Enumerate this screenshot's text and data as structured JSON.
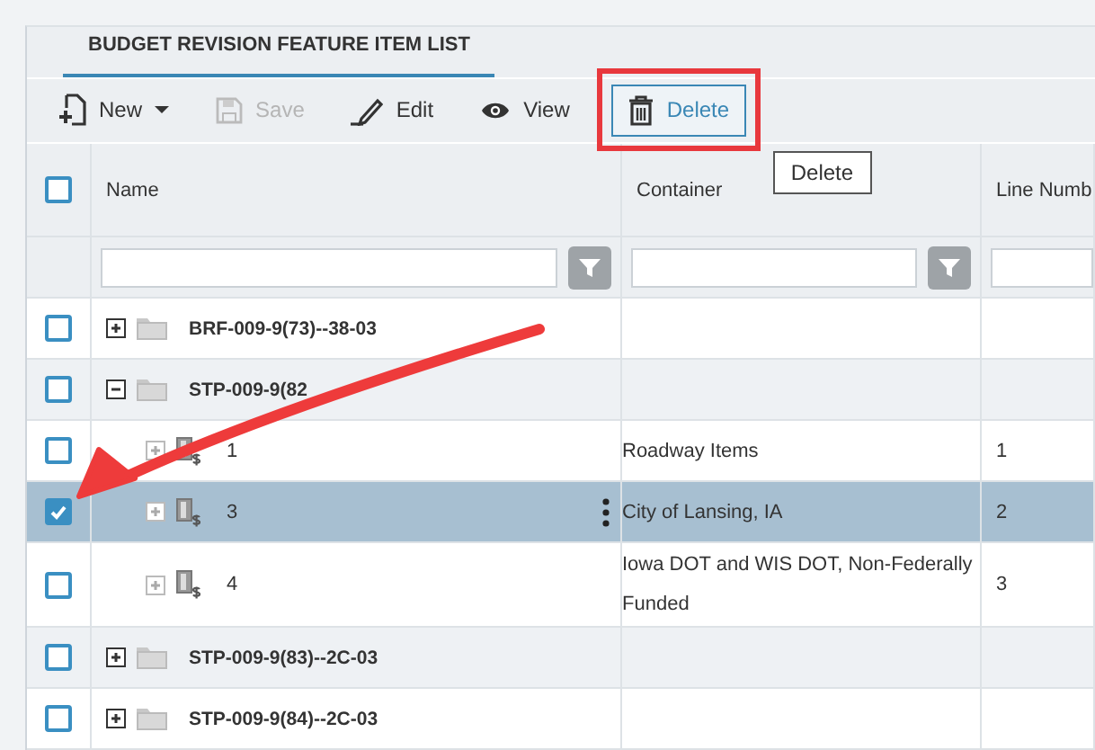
{
  "tab": {
    "label": "BUDGET REVISION FEATURE ITEM LIST",
    "selected": true
  },
  "toolbar": [
    {
      "kind": "new",
      "label": "New",
      "dropdown": true,
      "disabled": false,
      "hovered": false
    },
    {
      "kind": "save",
      "label": "Save",
      "dropdown": false,
      "disabled": true,
      "hovered": false
    },
    {
      "kind": "edit",
      "label": "Edit",
      "dropdown": false,
      "disabled": false,
      "hovered": false
    },
    {
      "kind": "view",
      "label": "View",
      "dropdown": false,
      "disabled": false,
      "hovered": false
    },
    {
      "kind": "delete",
      "label": "Delete",
      "dropdown": false,
      "disabled": false,
      "hovered": true
    }
  ],
  "tooltip": "Delete",
  "table": {
    "select_all": {
      "checked": false
    },
    "columns": [
      {
        "label": "Name",
        "filter_button": true
      },
      {
        "label": "Container",
        "filter_button": true
      },
      {
        "label": "Line Numb",
        "filter_button": false
      }
    ],
    "rows": [
      {
        "kind": "folder",
        "name": "BRF-009-9(73)--38-03",
        "checked": false,
        "selected": false,
        "expanded": false
      },
      {
        "kind": "folder",
        "name": "STP-009-9(82",
        "checked": false,
        "selected": false,
        "expanded": true,
        "children": [
          {
            "kind": "item",
            "name": "1",
            "container": "Roadway Items",
            "line_number": "1",
            "checked": false,
            "selected": false,
            "expanded": false
          },
          {
            "kind": "item",
            "name": "3",
            "container": "City of Lansing, IA",
            "line_number": "2",
            "checked": true,
            "selected": true,
            "expanded": false
          },
          {
            "kind": "item",
            "name": "4",
            "container": "Iowa DOT and WIS DOT, Non-Federally Funded",
            "line_number": "3",
            "checked": false,
            "selected": false,
            "expanded": false
          }
        ]
      },
      {
        "kind": "folder",
        "name": "STP-009-9(83)--2C-03",
        "checked": false,
        "selected": false,
        "expanded": false
      },
      {
        "kind": "folder",
        "name": "STP-009-9(84)--2C-03",
        "checked": false,
        "selected": false,
        "expanded": false
      }
    ]
  }
}
